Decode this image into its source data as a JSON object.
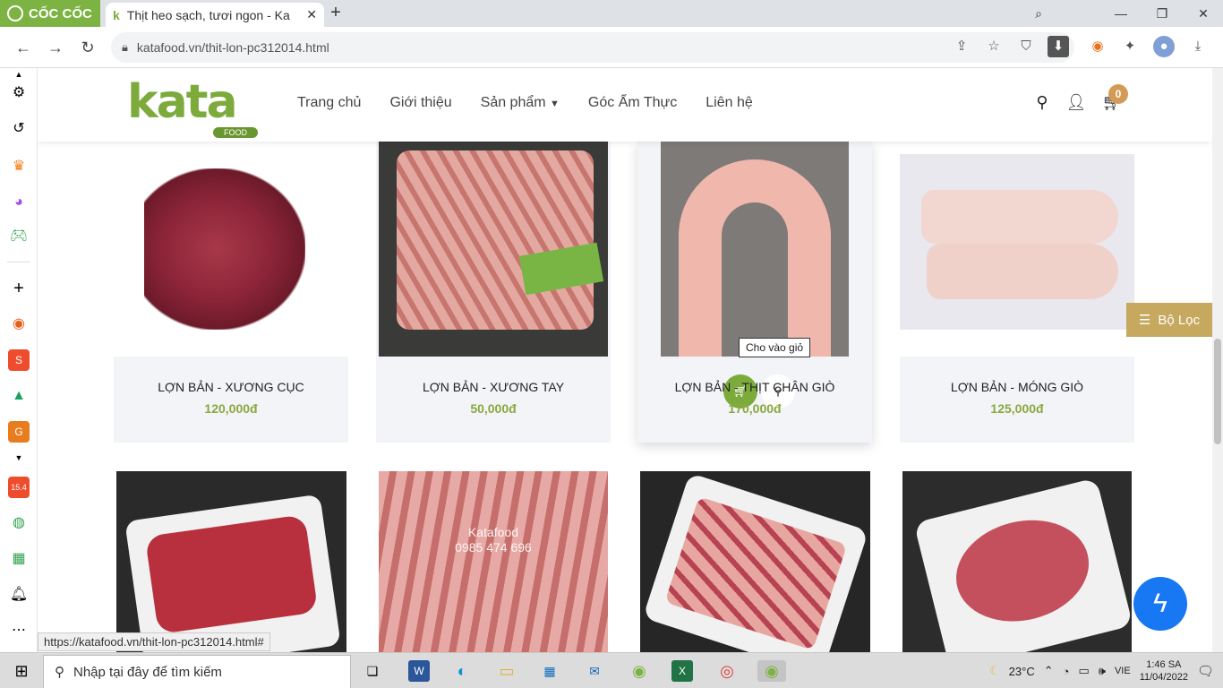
{
  "browser": {
    "brand": "CỐC CỐC",
    "tab_title": "Thịt heo sạch, tươi ngon - Ka",
    "url": "katafood.vn/thit-lon-pc312014.html"
  },
  "site": {
    "logo_text": "kata",
    "logo_sub": "FOOD",
    "nav": [
      "Trang chủ",
      "Giới thiệu",
      "Sản phẩm",
      "Góc Ẩm Thực",
      "Liên hệ"
    ],
    "cart_count": "0"
  },
  "products": [
    {
      "name": "LỢN BẢN - XƯƠNG CỤC",
      "price": "120,000đ"
    },
    {
      "name": "LỢN BẢN - XƯƠNG TAY",
      "price": "50,000đ"
    },
    {
      "name": "LỢN BẢN - THỊT CHÂN GIÒ",
      "price": "170,000đ"
    },
    {
      "name": "LỢN BẢN - MÓNG GIÒ",
      "price": "125,000đ"
    }
  ],
  "watermark": {
    "line1": "Katafood",
    "line2": "0985 474 696"
  },
  "tooltip": "Cho vào giỏ",
  "filter_label": "Bộ Lọc",
  "status_url": "https://katafood.vn/thit-lon-pc312014.html#",
  "taskbar": {
    "search_placeholder": "Nhập tại đây để tìm kiếm",
    "weather": "23°C",
    "lang": "VIE",
    "time": "1:46 SA",
    "date": "11/04/2022"
  },
  "colors": {
    "brand_green": "#7cab3c",
    "price_green": "#8aa83d",
    "filter_gold": "#c6a85f",
    "messenger_blue": "#1877f2"
  }
}
